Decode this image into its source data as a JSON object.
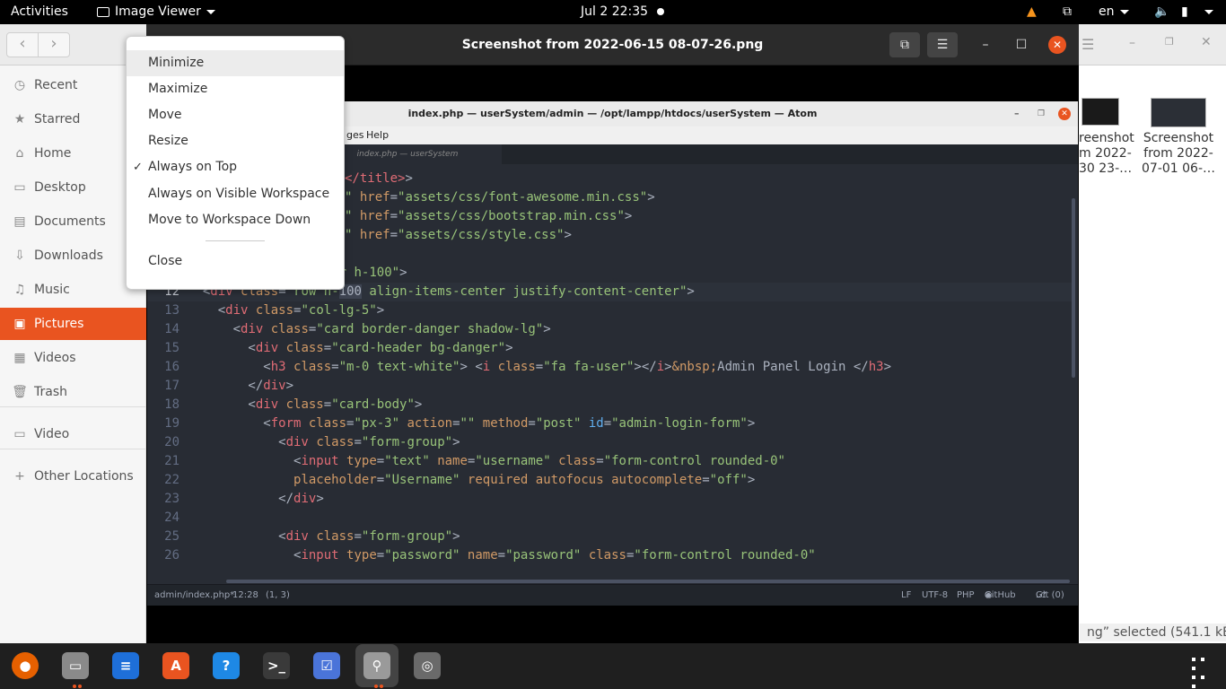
{
  "topbar": {
    "activities": "Activities",
    "app_name": "Image Viewer",
    "clock": "Jul 2  22:35",
    "lang": "en"
  },
  "files": {
    "sidebar": {
      "items": [
        {
          "label": "Recent",
          "icon": "clock-icon"
        },
        {
          "label": "Starred",
          "icon": "star-icon"
        },
        {
          "label": "Home",
          "icon": "home-icon"
        },
        {
          "label": "Desktop",
          "icon": "desktop-icon"
        },
        {
          "label": "Documents",
          "icon": "document-icon"
        },
        {
          "label": "Downloads",
          "icon": "download-icon"
        },
        {
          "label": "Music",
          "icon": "music-icon"
        },
        {
          "label": "Pictures",
          "icon": "picture-icon"
        },
        {
          "label": "Videos",
          "icon": "video-icon"
        },
        {
          "label": "Trash",
          "icon": "trash-icon"
        },
        {
          "label": "Video",
          "icon": "folder-icon"
        },
        {
          "label": "Other Locations",
          "icon": "plus-icon"
        }
      ],
      "active_index": 7
    },
    "files": [
      {
        "label_lines": [
          "reenshot",
          "m 2022-",
          "30 23-…"
        ]
      },
      {
        "label_lines": [
          "Screenshot",
          "from 2022-",
          "07-01 06-…"
        ]
      }
    ],
    "status": "ng” selected  (541.1 kB)"
  },
  "viewer": {
    "title": "Screenshot from 2022-06-15 08-07-26.png"
  },
  "atom": {
    "title": "index.php — userSystem/admin — /opt/lampp/htdocs/userSystem — Atom",
    "menu_visible": [
      "ges",
      "Help"
    ],
    "tab": "index.php — userSystem",
    "status": {
      "file": "admin/index.php*",
      "cursor": "12:28",
      "selection": "(1, 3)",
      "eol": "LF",
      "encoding": "UTF-8",
      "grammar": "PHP",
      "github": "GitHub",
      "git": "Git (0)"
    },
    "lines": [
      {
        "n": "",
        "segs": [
          [
            "t",
            "</title>"
          ],
          [
            "p",
            ">"
          ]
        ]
      },
      {
        "n": "",
        "segs": [
          [
            "s",
            "\""
          ],
          [
            "p",
            " "
          ],
          [
            "a",
            "href"
          ],
          [
            "p",
            "="
          ],
          [
            "s",
            "\"assets/css/font-awesome.min.css\""
          ],
          [
            "p",
            ">"
          ]
        ]
      },
      {
        "n": "",
        "segs": [
          [
            "s",
            "\""
          ],
          [
            "p",
            " "
          ],
          [
            "a",
            "href"
          ],
          [
            "p",
            "="
          ],
          [
            "s",
            "\"assets/css/bootstrap.min.css\""
          ],
          [
            "p",
            ">"
          ]
        ]
      },
      {
        "n": "",
        "segs": [
          [
            "s",
            "\""
          ],
          [
            "p",
            " "
          ],
          [
            "a",
            "href"
          ],
          [
            "p",
            "="
          ],
          [
            "s",
            "\"assets/css/style.css\""
          ],
          [
            "p",
            ">"
          ]
        ]
      },
      {
        "n": "",
        "segs": []
      },
      {
        "n": "11",
        "segs": [
          [
            "p",
            ":"
          ],
          [
            "t",
            "div"
          ],
          [
            "p",
            " "
          ],
          [
            "a",
            "class"
          ],
          [
            "p",
            "="
          ],
          [
            "s",
            "\"container h-100\""
          ],
          [
            "p",
            ">"
          ]
        ]
      },
      {
        "n": "12",
        "segs": [
          [
            "p",
            "  <"
          ],
          [
            "t",
            "div"
          ],
          [
            "p",
            " "
          ],
          [
            "a",
            "class"
          ],
          [
            "p",
            "="
          ],
          [
            "s",
            "\"row h-"
          ],
          [
            "h",
            "100"
          ],
          [
            "s",
            " align-items-center justify-content-center\""
          ],
          [
            "p",
            ">"
          ]
        ]
      },
      {
        "n": "13",
        "segs": [
          [
            "p",
            "    <"
          ],
          [
            "t",
            "div"
          ],
          [
            "p",
            " "
          ],
          [
            "a",
            "class"
          ],
          [
            "p",
            "="
          ],
          [
            "s",
            "\"col-lg-5\""
          ],
          [
            "p",
            ">"
          ]
        ]
      },
      {
        "n": "14",
        "segs": [
          [
            "p",
            "      <"
          ],
          [
            "t",
            "div"
          ],
          [
            "p",
            " "
          ],
          [
            "a",
            "class"
          ],
          [
            "p",
            "="
          ],
          [
            "s",
            "\"card border-danger shadow-lg\""
          ],
          [
            "p",
            ">"
          ]
        ]
      },
      {
        "n": "15",
        "segs": [
          [
            "p",
            "        <"
          ],
          [
            "t",
            "div"
          ],
          [
            "p",
            " "
          ],
          [
            "a",
            "class"
          ],
          [
            "p",
            "="
          ],
          [
            "s",
            "\"card-header bg-danger\""
          ],
          [
            "p",
            ">"
          ]
        ]
      },
      {
        "n": "16",
        "segs": [
          [
            "p",
            "          <"
          ],
          [
            "t",
            "h3"
          ],
          [
            "p",
            " "
          ],
          [
            "a",
            "class"
          ],
          [
            "p",
            "="
          ],
          [
            "s",
            "\"m-0 text-white\""
          ],
          [
            "p",
            "> <"
          ],
          [
            "t",
            "i"
          ],
          [
            "p",
            " "
          ],
          [
            "a",
            "class"
          ],
          [
            "p",
            "="
          ],
          [
            "s",
            "\"fa fa-user\""
          ],
          [
            "p",
            "></"
          ],
          [
            "t",
            "i"
          ],
          [
            "p",
            ">"
          ],
          [
            "a",
            "&nbsp;"
          ],
          [
            "p",
            "Admin Panel Login </"
          ],
          [
            "t",
            "h3"
          ],
          [
            "p",
            ">"
          ]
        ]
      },
      {
        "n": "17",
        "segs": [
          [
            "p",
            "        </"
          ],
          [
            "t",
            "div"
          ],
          [
            "p",
            ">"
          ]
        ]
      },
      {
        "n": "18",
        "segs": [
          [
            "p",
            "        <"
          ],
          [
            "t",
            "div"
          ],
          [
            "p",
            " "
          ],
          [
            "a",
            "class"
          ],
          [
            "p",
            "="
          ],
          [
            "s",
            "\"card-body\""
          ],
          [
            "p",
            ">"
          ]
        ]
      },
      {
        "n": "19",
        "segs": [
          [
            "p",
            "          <"
          ],
          [
            "t",
            "form"
          ],
          [
            "p",
            " "
          ],
          [
            "a",
            "class"
          ],
          [
            "p",
            "="
          ],
          [
            "s",
            "\"px-3\""
          ],
          [
            "p",
            " "
          ],
          [
            "a",
            "action"
          ],
          [
            "p",
            "="
          ],
          [
            "s",
            "\"\""
          ],
          [
            "p",
            " "
          ],
          [
            "a",
            "method"
          ],
          [
            "p",
            "="
          ],
          [
            "s",
            "\"post\""
          ],
          [
            "p",
            " "
          ],
          [
            "b",
            "id"
          ],
          [
            "p",
            "="
          ],
          [
            "s",
            "\"admin-login-form\""
          ],
          [
            "p",
            ">"
          ]
        ]
      },
      {
        "n": "20",
        "segs": [
          [
            "p",
            "            <"
          ],
          [
            "t",
            "div"
          ],
          [
            "p",
            " "
          ],
          [
            "a",
            "class"
          ],
          [
            "p",
            "="
          ],
          [
            "s",
            "\"form-group\""
          ],
          [
            "p",
            ">"
          ]
        ]
      },
      {
        "n": "21",
        "segs": [
          [
            "p",
            "              <"
          ],
          [
            "t",
            "input"
          ],
          [
            "p",
            " "
          ],
          [
            "a",
            "type"
          ],
          [
            "p",
            "="
          ],
          [
            "s",
            "\"text\""
          ],
          [
            "p",
            " "
          ],
          [
            "a",
            "name"
          ],
          [
            "p",
            "="
          ],
          [
            "s",
            "\"username\""
          ],
          [
            "p",
            " "
          ],
          [
            "a",
            "class"
          ],
          [
            "p",
            "="
          ],
          [
            "s",
            "\"form-control rounded-0\""
          ]
        ]
      },
      {
        "n": "22",
        "segs": [
          [
            "p",
            "              "
          ],
          [
            "a",
            "placeholder"
          ],
          [
            "p",
            "="
          ],
          [
            "s",
            "\"Username\""
          ],
          [
            "p",
            " "
          ],
          [
            "a",
            "required"
          ],
          [
            "p",
            " "
          ],
          [
            "a",
            "autofocus"
          ],
          [
            "p",
            " "
          ],
          [
            "a",
            "autocomplete"
          ],
          [
            "p",
            "="
          ],
          [
            "s",
            "\"off\""
          ],
          [
            "p",
            ">"
          ]
        ]
      },
      {
        "n": "23",
        "segs": [
          [
            "p",
            "            </"
          ],
          [
            "t",
            "div"
          ],
          [
            "p",
            ">"
          ]
        ]
      },
      {
        "n": "24",
        "segs": []
      },
      {
        "n": "25",
        "segs": [
          [
            "p",
            "            <"
          ],
          [
            "t",
            "div"
          ],
          [
            "p",
            " "
          ],
          [
            "a",
            "class"
          ],
          [
            "p",
            "="
          ],
          [
            "s",
            "\"form-group\""
          ],
          [
            "p",
            ">"
          ]
        ]
      },
      {
        "n": "26",
        "segs": [
          [
            "p",
            "              <"
          ],
          [
            "t",
            "input"
          ],
          [
            "p",
            " "
          ],
          [
            "a",
            "type"
          ],
          [
            "p",
            "="
          ],
          [
            "s",
            "\"password\""
          ],
          [
            "p",
            " "
          ],
          [
            "a",
            "name"
          ],
          [
            "p",
            "="
          ],
          [
            "s",
            "\"password\""
          ],
          [
            "p",
            " "
          ],
          [
            "a",
            "class"
          ],
          [
            "p",
            "="
          ],
          [
            "s",
            "\"form-control rounded-0\""
          ]
        ]
      }
    ],
    "current_line_index": 6
  },
  "context_menu": {
    "items": [
      {
        "label": "Minimize",
        "checked": false
      },
      {
        "label": "Maximize",
        "checked": false
      },
      {
        "label": "Move",
        "checked": false
      },
      {
        "label": "Resize",
        "checked": false
      },
      {
        "label": "Always on Top",
        "checked": true
      },
      {
        "label": "Always on Visible Workspace",
        "checked": false
      },
      {
        "label": "Move to Workspace Down",
        "checked": false
      }
    ],
    "close_label": "Close",
    "check_glyph": "✓"
  },
  "dock": {
    "apps": [
      {
        "name": "firefox-icon",
        "glyph": "●",
        "color": "#e66000"
      },
      {
        "name": "files-icon",
        "glyph": "▭",
        "color": "#8a8a8a"
      },
      {
        "name": "writer-icon",
        "glyph": "≡",
        "color": "#1e6fd9"
      },
      {
        "name": "software-icon",
        "glyph": "A",
        "color": "#e95420"
      },
      {
        "name": "help-icon",
        "glyph": "?",
        "color": "#1e88e5"
      },
      {
        "name": "terminal-icon",
        "glyph": ">_",
        "color": "#3a3a3a"
      },
      {
        "name": "tasks-icon",
        "glyph": "☑",
        "color": "#4a74d9"
      },
      {
        "name": "image-viewer-icon",
        "glyph": "⚲",
        "color": "#9a9a9a"
      },
      {
        "name": "disc-icon",
        "glyph": "◎",
        "color": "#6a6a6a"
      }
    ],
    "grid_glyph": "⋮⋮⋮"
  }
}
